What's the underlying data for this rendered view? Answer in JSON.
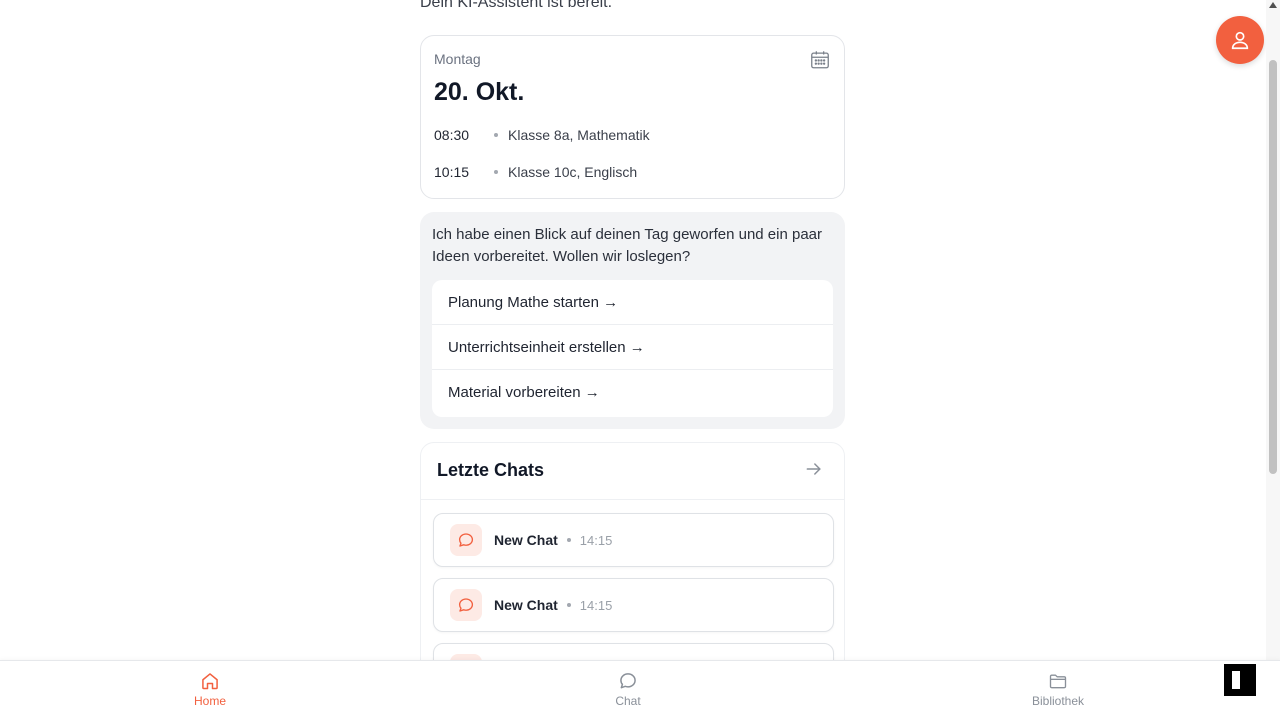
{
  "header": {
    "subtitle": "Dein KI-Assistent ist bereit."
  },
  "calendar": {
    "weekday": "Montag",
    "date": "20. Okt.",
    "events": [
      {
        "time": "08:30",
        "description": "Klasse 8a, Mathematik"
      },
      {
        "time": "10:15",
        "description": "Klasse 10c, Englisch"
      }
    ]
  },
  "assistant": {
    "message": "Ich habe einen Blick auf deinen Tag geworfen und ein paar Ideen vorbereitet. Wollen wir loslegen?",
    "actions": [
      {
        "label": "Planung Mathe starten →"
      },
      {
        "label": "Unterrichtseinheit erstellen →"
      },
      {
        "label": "Material vorbereiten →"
      }
    ]
  },
  "recent_chats": {
    "title": "Letzte Chats",
    "items": [
      {
        "name": "New Chat",
        "time": "14:15"
      },
      {
        "name": "New Chat",
        "time": "14:15"
      }
    ]
  },
  "bottom_nav": {
    "items": [
      {
        "label": "Home",
        "icon": "home-icon",
        "active": true
      },
      {
        "label": "Chat",
        "icon": "chat-icon",
        "active": false
      },
      {
        "label": "Bibliothek",
        "icon": "folder-icon",
        "active": false
      }
    ]
  },
  "colors": {
    "accent": "#f2603f",
    "accent_soft": "#fdeae5",
    "muted_text": "#6b7280",
    "card_gray": "#f2f3f5"
  }
}
